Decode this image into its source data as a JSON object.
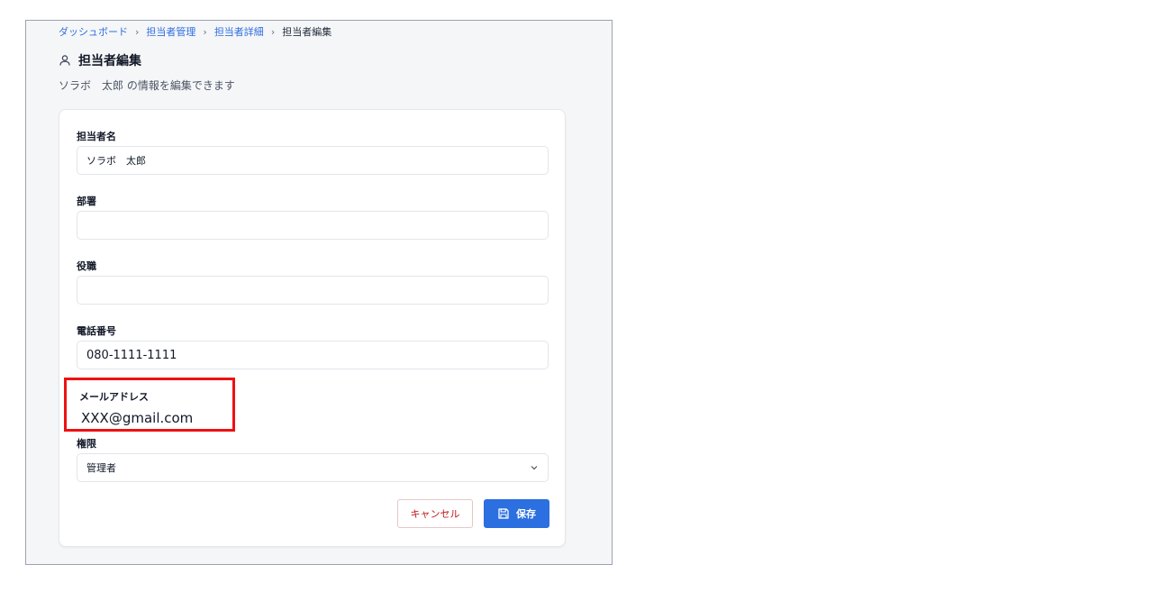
{
  "breadcrumb": {
    "items": [
      "ダッシュボード",
      "担当者管理",
      "担当者詳細"
    ],
    "current": "担当者編集",
    "separator": "›"
  },
  "header": {
    "icon": "user-icon",
    "title": "担当者編集",
    "subtitle": "ソラボ　太郎 の情報を編集できます"
  },
  "form": {
    "name": {
      "label": "担当者名",
      "value": "ソラボ　太郎"
    },
    "department": {
      "label": "部署",
      "value": ""
    },
    "position": {
      "label": "役職",
      "value": ""
    },
    "phone": {
      "label": "電話番号",
      "value": "080-1111-1111"
    },
    "email": {
      "label": "メールアドレス",
      "value": "XXX@gmail.com"
    },
    "role": {
      "label": "権限",
      "value": "管理者",
      "icon": "chevron-down-icon"
    }
  },
  "actions": {
    "cancel_label": "キャンセル",
    "save_label": "保存",
    "save_icon": "save-icon"
  },
  "colors": {
    "link": "#2f6fde",
    "primary": "#2b6fe0",
    "cancel_text": "#c01818",
    "highlight": "#ee1111"
  }
}
